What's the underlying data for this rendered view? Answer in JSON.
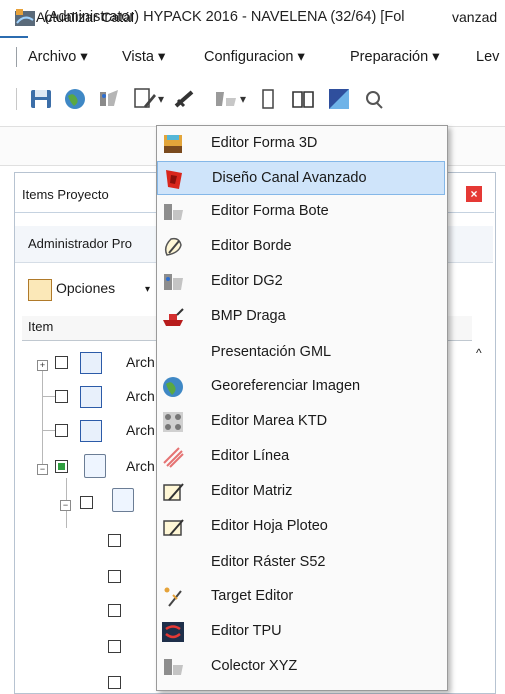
{
  "window": {
    "title": "(Administrator) HYPACK 2016 - NAVELENA (32/64)  [Fol"
  },
  "menubar": {
    "items": [
      "Archivo",
      "Vista",
      "Configuracion",
      "Preparación",
      "Lev"
    ],
    "caret": "▾"
  },
  "toolbar": {
    "arrow": "▾"
  },
  "row2": {
    "actualizar": "Actualizar Catál",
    "avanzad": "vanzad"
  },
  "panel": {
    "title": "Items Proyecto",
    "close": "×",
    "admin_tab": "Administrador Pro",
    "opciones": "Opciones",
    "opciones_caret": "▾",
    "column_header": "Item",
    "scroll_up": "^"
  },
  "tree": {
    "items": [
      {
        "label": "Arch",
        "toggle": "+"
      },
      {
        "label": "Arch"
      },
      {
        "label": "Arch"
      },
      {
        "label": "Arch",
        "toggle": "−"
      }
    ],
    "sub_toggle": "−"
  },
  "dropdown": {
    "highlight_color": "#cfe4fa",
    "items": [
      {
        "label": "Editor Forma 3D",
        "icon": "shape-3d-icon"
      },
      {
        "label": "Diseño Canal Avanzado",
        "icon": "advanced-channel-icon"
      },
      {
        "label": "Editor Forma Bote",
        "icon": "boat-shape-icon"
      },
      {
        "label": "Editor Borde",
        "icon": "border-editor-icon"
      },
      {
        "label": "Editor DG2",
        "icon": "dg2-editor-icon"
      },
      {
        "label": "BMP Draga",
        "icon": "dredge-icon"
      },
      {
        "label": "Presentación GML",
        "icon": ""
      },
      {
        "label": "Georeferenciar Imagen",
        "icon": "globe-icon"
      },
      {
        "label": "Editor Marea KTD",
        "icon": "tide-ktd-icon"
      },
      {
        "label": "Editor Línea",
        "icon": "line-editor-icon"
      },
      {
        "label": "Editor Matriz",
        "icon": "matrix-editor-icon"
      },
      {
        "label": "Editor Hoja Ploteo",
        "icon": "plot-sheet-icon"
      },
      {
        "label": "Editor Ráster S52",
        "icon": ""
      },
      {
        "label": "Target Editor",
        "icon": "target-editor-icon"
      },
      {
        "label": "Editor TPU",
        "icon": "tpu-editor-icon"
      },
      {
        "label": "Colector XYZ",
        "icon": "xyz-collector-icon"
      }
    ]
  }
}
